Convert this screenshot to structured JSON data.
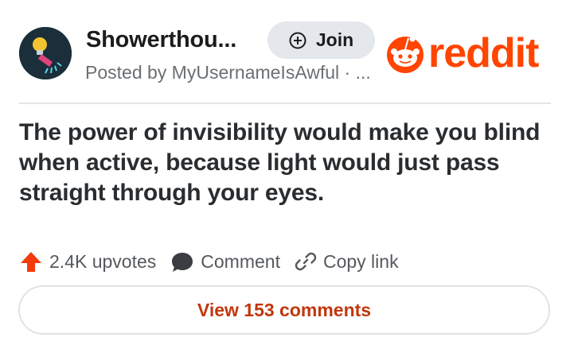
{
  "post": {
    "subreddit_name": "Showerthou...",
    "posted_by": "Posted by MyUsernameIsAwful · ...",
    "title": "The power of invisibility would make you blind when active, because light would just pass straight through your eyes."
  },
  "header": {
    "join_label": "Join",
    "brand_wordmark": "reddit"
  },
  "actions": {
    "upvotes_label": "2.4K upvotes",
    "comment_label": "Comment",
    "copy_link_label": "Copy link"
  },
  "footer": {
    "view_comments_label": "View 153 comments"
  },
  "colors": {
    "brand": "#ff4500",
    "comments_link": "#c1370c",
    "avatar_background": "#1a2f3a"
  },
  "icons": {
    "avatar": "shower-head-icon",
    "join": "plus-circle-icon",
    "logo": "reddit-snoo-icon",
    "upvote": "upvote-arrow-icon",
    "comment": "comment-bubble-icon",
    "copy_link": "link-chain-icon"
  }
}
